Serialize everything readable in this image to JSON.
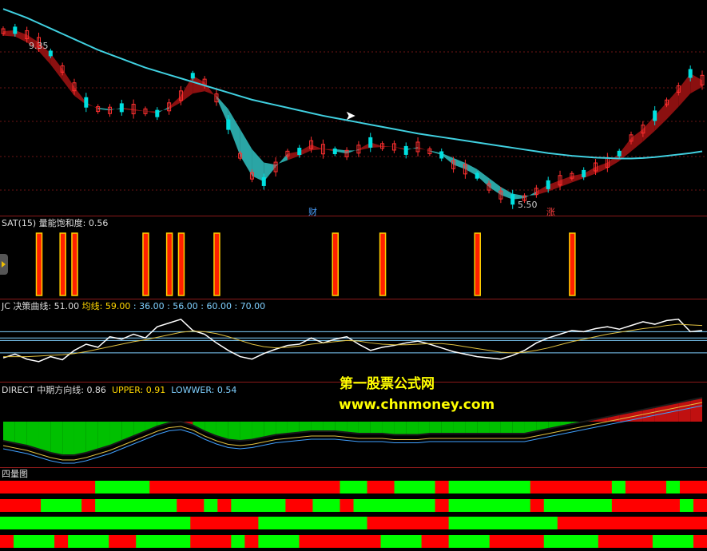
{
  "main_panel": {
    "high_label": "9.35",
    "low_label": "5.50",
    "marker_cai": "财",
    "marker_zhang": "涨"
  },
  "sat_panel": {
    "title": "SAT(15)",
    "label": "量能饱和度:",
    "value": "0.56"
  },
  "jc_panel": {
    "title": "JC",
    "label": "决策曲线:",
    "value": "51.00",
    "avg_label": "均线:",
    "avg_value": "59.00",
    "levels": ": 36.00 : 56.00 : 60.00 : 70.00"
  },
  "direct_panel": {
    "title": "DIRECT",
    "label": "中期方向线:",
    "value": "0.86",
    "upper_label": "UPPER:",
    "upper_value": "0.91",
    "lower_label": "LOWWER:",
    "lower_value": "0.54"
  },
  "quad_panel": {
    "title": "四量图"
  },
  "watermark": {
    "line1": "第一股票公式网",
    "line2": "www.chnmoney.com"
  },
  "colors": {
    "up": "#ff3030",
    "down": "#00e0e0",
    "cyan_band": "#2aa5a5",
    "red_band": "#8b1010",
    "green": "#00e000",
    "red": "#ff0000",
    "bull": "#00ff00",
    "separator": "#8b1a1a"
  },
  "chart_data": {
    "type": "line",
    "x": [
      0,
      1,
      2,
      3,
      4,
      5,
      6,
      7,
      8,
      9,
      10,
      11,
      12,
      13,
      14,
      15,
      16,
      17,
      18,
      19,
      20,
      21,
      22,
      23,
      24,
      25,
      26,
      27,
      28,
      29,
      30,
      31,
      32,
      33,
      34,
      35,
      36,
      37,
      38,
      39,
      40,
      41,
      42,
      43,
      44,
      45,
      46,
      47,
      48,
      49,
      50,
      51,
      52,
      53,
      54,
      55,
      56,
      57,
      58,
      59
    ],
    "series": [
      {
        "values": [
          9.3,
          9.32,
          9.22,
          9.05,
          8.8,
          8.45,
          8.05,
          7.7,
          7.55,
          7.52,
          7.58,
          7.55,
          7.5,
          7.45,
          7.6,
          7.85,
          8.3,
          8.15,
          7.8,
          7.2,
          6.5,
          6.05,
          5.92,
          6.25,
          6.55,
          6.6,
          6.75,
          6.65,
          6.6,
          6.55,
          6.65,
          6.8,
          6.72,
          6.7,
          6.62,
          6.7,
          6.6,
          6.52,
          6.3,
          6.2,
          6.05,
          5.8,
          5.62,
          5.52,
          5.55,
          5.7,
          5.85,
          5.95,
          6.05,
          6.1,
          6.25,
          6.35,
          6.55,
          6.9,
          7.1,
          7.4,
          7.7,
          8.0,
          8.35,
          8.2
        ]
      },
      {
        "values": [
          9.2,
          9.18,
          9.05,
          8.85,
          8.55,
          8.2,
          7.85,
          7.65,
          7.58,
          7.55,
          7.55,
          7.52,
          7.5,
          7.5,
          7.55,
          7.7,
          7.9,
          7.95,
          7.85,
          7.55,
          7.1,
          6.65,
          6.35,
          6.3,
          6.4,
          6.5,
          6.62,
          6.65,
          6.65,
          6.62,
          6.62,
          6.68,
          6.7,
          6.7,
          6.66,
          6.66,
          6.62,
          6.56,
          6.45,
          6.34,
          6.2,
          6.0,
          5.8,
          5.65,
          5.6,
          5.62,
          5.7,
          5.8,
          5.9,
          6.0,
          6.1,
          6.22,
          6.38,
          6.6,
          6.82,
          7.06,
          7.32,
          7.6,
          7.9,
          8.05
        ]
      },
      {
        "values": [
          9.8,
          9.7,
          9.6,
          9.48,
          9.36,
          9.24,
          9.12,
          9.0,
          8.88,
          8.78,
          8.68,
          8.58,
          8.48,
          8.4,
          8.32,
          8.24,
          8.16,
          8.08,
          8.0,
          7.92,
          7.84,
          7.76,
          7.7,
          7.64,
          7.58,
          7.52,
          7.46,
          7.4,
          7.35,
          7.3,
          7.25,
          7.2,
          7.15,
          7.1,
          7.05,
          7.0,
          6.96,
          6.92,
          6.88,
          6.84,
          6.8,
          6.76,
          6.72,
          6.68,
          6.64,
          6.6,
          6.56,
          6.53,
          6.5,
          6.48,
          6.46,
          6.45,
          6.44,
          6.44,
          6.45,
          6.47,
          6.5,
          6.53,
          6.56,
          6.6
        ]
      },
      {
        "values": [
          28,
          34,
          26,
          22,
          30,
          25,
          40,
          50,
          45,
          62,
          58,
          66,
          60,
          78,
          84,
          90,
          72,
          66,
          52,
          40,
          30,
          26,
          35,
          42,
          48,
          50,
          60,
          52,
          58,
          62,
          50,
          40,
          45,
          48,
          52,
          55,
          50,
          44,
          38,
          34,
          30,
          28,
          26,
          32,
          40,
          52,
          60,
          66,
          72,
          70,
          75,
          78,
          74,
          80,
          86,
          82,
          88,
          90,
          70,
          72
        ]
      },
      {
        "values": [
          30,
          30,
          30,
          31,
          32,
          33,
          35,
          38,
          42,
          46,
          50,
          54,
          57,
          61,
          65,
          69,
          71,
          70,
          67,
          62,
          56,
          50,
          46,
          44,
          45,
          47,
          50,
          52,
          54,
          56,
          55,
          52,
          50,
          49,
          49,
          50,
          51,
          51,
          49,
          46,
          43,
          40,
          37,
          36,
          37,
          40,
          44,
          49,
          54,
          58,
          62,
          66,
          69,
          72,
          75,
          77,
          80,
          82,
          81,
          80
        ]
      },
      {
        "values": [
          0.62,
          0.6,
          0.58,
          0.55,
          0.52,
          0.5,
          0.5,
          0.52,
          0.55,
          0.58,
          0.62,
          0.66,
          0.7,
          0.74,
          0.77,
          0.78,
          0.75,
          0.7,
          0.66,
          0.63,
          0.62,
          0.63,
          0.65,
          0.67,
          0.68,
          0.69,
          0.7,
          0.7,
          0.7,
          0.69,
          0.68,
          0.68,
          0.68,
          0.67,
          0.67,
          0.67,
          0.68,
          0.68,
          0.68,
          0.68,
          0.68,
          0.68,
          0.68,
          0.68,
          0.68,
          0.7,
          0.72,
          0.74,
          0.76,
          0.78,
          0.8,
          0.82,
          0.84,
          0.86,
          0.88,
          0.9,
          0.92,
          0.94,
          0.96,
          0.98
        ]
      }
    ],
    "sat_bars": [
      3,
      5,
      6,
      12,
      14,
      15,
      18,
      28,
      32,
      40,
      48
    ],
    "jc_levels": [
      36,
      56,
      60,
      70
    ],
    "quad_rows": [
      [
        "R",
        "R",
        "R",
        "R",
        "R",
        "R",
        "R",
        "G",
        "G",
        "G",
        "G",
        "R",
        "R",
        "R",
        "R",
        "R",
        "R",
        "R",
        "R",
        "R",
        "R",
        "R",
        "R",
        "R",
        "R",
        "G",
        "G",
        "R",
        "R",
        "G",
        "G",
        "G",
        "R",
        "G",
        "G",
        "G",
        "G",
        "G",
        "G",
        "R",
        "R",
        "R",
        "R",
        "R",
        "R",
        "G",
        "R",
        "R",
        "R",
        "G",
        "R",
        "R"
      ],
      [
        "R",
        "R",
        "R",
        "G",
        "G",
        "G",
        "R",
        "G",
        "G",
        "G",
        "G",
        "G",
        "G",
        "R",
        "R",
        "G",
        "R",
        "G",
        "G",
        "G",
        "G",
        "R",
        "R",
        "G",
        "G",
        "R",
        "G",
        "G",
        "G",
        "G",
        "G",
        "G",
        "R",
        "G",
        "G",
        "G",
        "G",
        "G",
        "G",
        "R",
        "G",
        "G",
        "G",
        "G",
        "G",
        "R",
        "R",
        "R",
        "R",
        "R",
        "G",
        "R"
      ],
      [
        "G",
        "G",
        "G",
        "G",
        "G",
        "G",
        "G",
        "G",
        "G",
        "G",
        "G",
        "G",
        "G",
        "G",
        "R",
        "R",
        "R",
        "R",
        "R",
        "G",
        "G",
        "G",
        "G",
        "G",
        "G",
        "G",
        "G",
        "R",
        "R",
        "R",
        "R",
        "R",
        "R",
        "G",
        "G",
        "G",
        "G",
        "G",
        "G",
        "G",
        "G",
        "R",
        "R",
        "R",
        "R",
        "R",
        "R",
        "R",
        "R",
        "R",
        "R",
        "R"
      ],
      [
        "R",
        "G",
        "G",
        "G",
        "R",
        "G",
        "G",
        "G",
        "R",
        "R",
        "G",
        "G",
        "G",
        "G",
        "R",
        "R",
        "R",
        "G",
        "R",
        "G",
        "G",
        "G",
        "R",
        "R",
        "R",
        "R",
        "R",
        "R",
        "G",
        "G",
        "G",
        "R",
        "R",
        "G",
        "G",
        "G",
        "R",
        "R",
        "R",
        "R",
        "G",
        "G",
        "G",
        "G",
        "R",
        "R",
        "R",
        "R",
        "G",
        "G",
        "G",
        "R"
      ]
    ]
  }
}
